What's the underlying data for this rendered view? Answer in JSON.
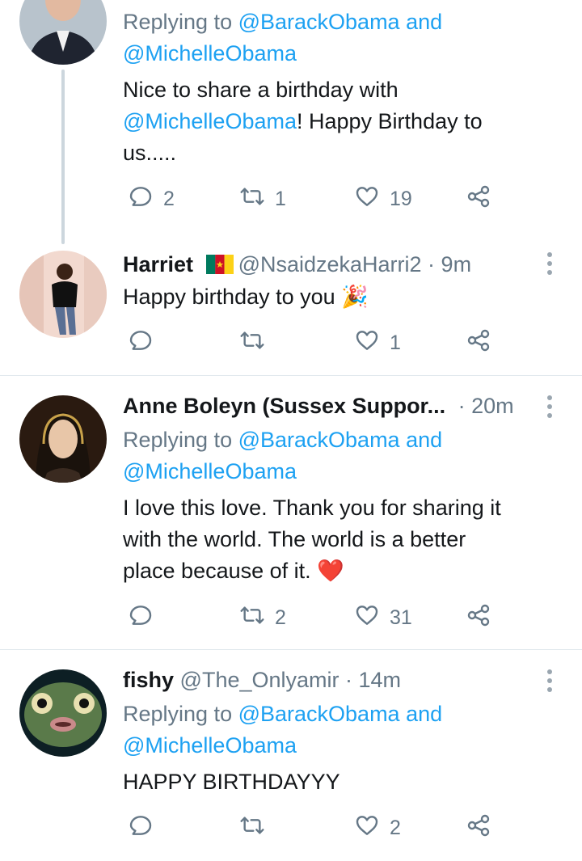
{
  "tweets": [
    {
      "reply_prefix": "Replying to ",
      "reply_to_1": "@BarackObama",
      "reply_and": " and",
      "reply_to_2": "@MichelleObama",
      "body_l1": "Nice to share a birthday with",
      "body_mention": "@MichelleObama",
      "body_l2_rest": "! Happy Birthday to",
      "body_l3": "us.....",
      "replies": "2",
      "retweets": "1",
      "likes": "19"
    },
    {
      "name": "Harriet",
      "flag": "cameroon-flag",
      "handle": "@NsaidzekaHarri2",
      "sep": " · ",
      "time": "9m",
      "body": "Happy birthday to you 🎉",
      "replies": "",
      "retweets": "",
      "likes": "1"
    },
    {
      "name": "Anne Boleyn (Sussex Suppor...",
      "sep": " · ",
      "time": "20m",
      "reply_prefix": "Replying to ",
      "reply_to_1": "@BarackObama",
      "reply_and": " and",
      "reply_to_2": "@MichelleObama",
      "body_l1": "I love this love. Thank you for sharing it",
      "body_l2": "with the world. The world is a better",
      "body_l3": "place because of it. ❤️",
      "replies": "",
      "retweets": "2",
      "likes": "31"
    },
    {
      "name": "fishy",
      "handle": "@The_Onlyamir",
      "sep": " · ",
      "time": "14m",
      "reply_prefix": "Replying to ",
      "reply_to_1": "@BarackObama",
      "reply_and": " and",
      "reply_to_2": "@MichelleObama",
      "body": "HAPPY BIRTHDAYYY",
      "replies": "",
      "retweets": "",
      "likes": "2"
    }
  ],
  "icons": [
    "reply-icon",
    "retweet-icon",
    "like-icon",
    "share-icon",
    "more-options-icon"
  ],
  "colors": {
    "link": "#1da1f2",
    "muted": "#657786",
    "text": "#14171a",
    "divider": "#e1e8ed"
  }
}
